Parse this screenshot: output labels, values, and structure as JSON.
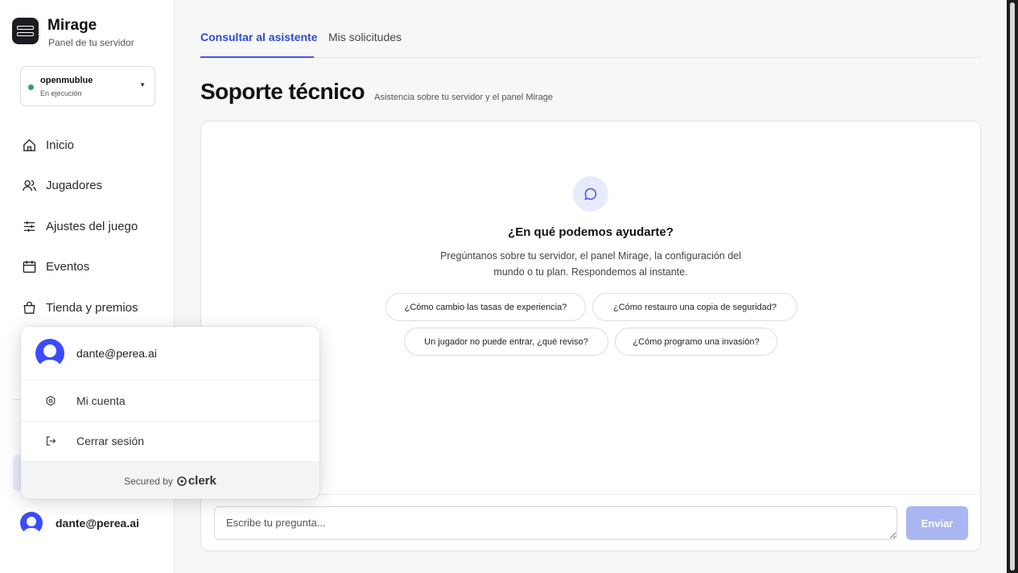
{
  "brand": {
    "name": "Mirage",
    "subtitle": "Panel de tu servidor"
  },
  "server": {
    "name": "openmublue",
    "status": "En ejecución",
    "status_color": "#2fa55a"
  },
  "nav": [
    {
      "label": "Inicio",
      "icon": "home-icon"
    },
    {
      "label": "Jugadores",
      "icon": "users-icon"
    },
    {
      "label": "Ajustes del juego",
      "icon": "sliders-icon"
    },
    {
      "label": "Eventos",
      "icon": "calendar-icon"
    },
    {
      "label": "Tienda y premios",
      "icon": "shopping-bag-icon"
    }
  ],
  "user": {
    "email": "dante@perea.ai"
  },
  "popover": {
    "email": "dante@perea.ai",
    "items": [
      {
        "label": "Mi cuenta",
        "icon": "settings-icon"
      },
      {
        "label": "Cerrar sesión",
        "icon": "sign-out-icon"
      }
    ],
    "footer_prefix": "Secured by",
    "footer_brand": "clerk"
  },
  "tabs": [
    {
      "label": "Consultar al asistente",
      "active": true
    },
    {
      "label": "Mis solicitudes",
      "active": false
    }
  ],
  "page": {
    "title": "Soporte técnico",
    "subtitle": "Asistencia sobre tu servidor y el panel Mirage"
  },
  "chat": {
    "icon": "chat-bubble-icon",
    "heading": "¿En qué podemos ayudarte?",
    "description": "Pregúntanos sobre tu servidor, el panel Mirage, la configuración del mundo o tu plan. Respondemos al instante.",
    "suggestions": [
      "¿Cómo cambio las tasas de experiencia?",
      "¿Cómo restauro una copia de seguridad?",
      "Un jugador no puede entrar, ¿qué reviso?",
      "¿Cómo programo una invasión?"
    ],
    "input_placeholder": "Escribe tu pregunta...",
    "send_label": "Enviar"
  },
  "colors": {
    "accent": "#3d56e0",
    "send_disabled": "#a9b6f2",
    "avatar": "#3b4cff"
  }
}
